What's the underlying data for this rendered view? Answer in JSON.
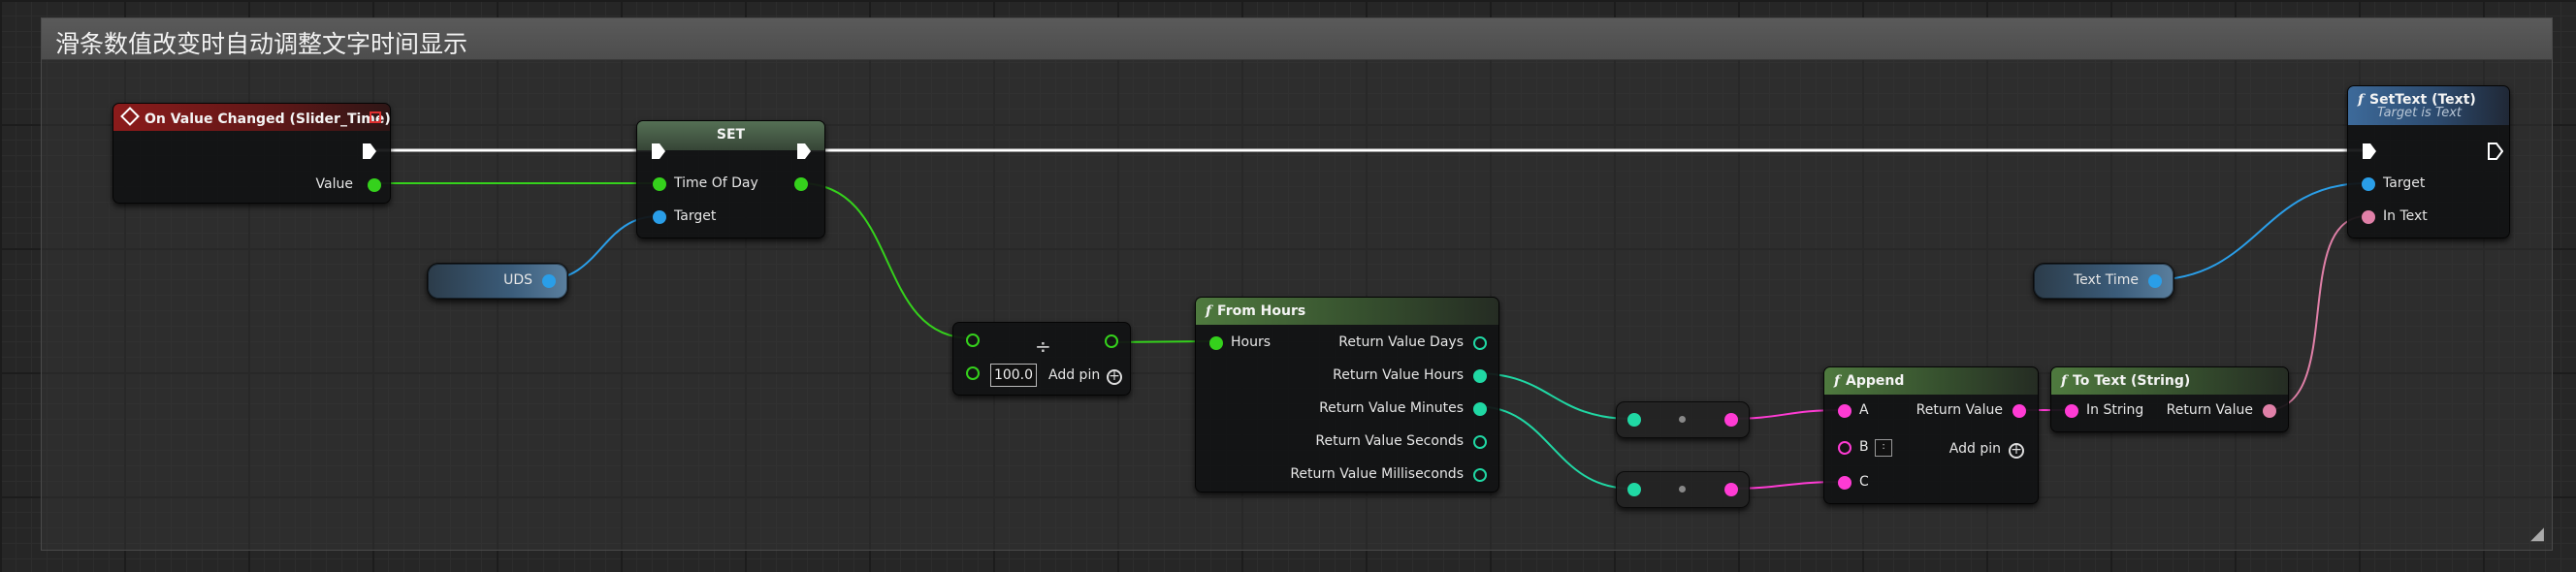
{
  "comment": {
    "title": "滑条数值改变时自动调整文字时间显示"
  },
  "colors": {
    "exec": "#ffffff",
    "float": "#35d11c",
    "object": "#2a9ee8",
    "string": "#ff3bd4",
    "text": "#e080a8",
    "integer": "#20d8a4",
    "event_header": "#8c1b1b",
    "pure_header": "#4f7a3f",
    "function_header": "#3d6a9a"
  },
  "event_node": {
    "title": "On Value Changed (Slider_Time)",
    "icon": "event-diamond-icon",
    "outputs": {
      "value": "Value"
    }
  },
  "set_node": {
    "title": "SET",
    "inputs": {
      "time_of_day": "Time Of Day",
      "target": "Target"
    }
  },
  "uds_node": {
    "label": "UDS"
  },
  "divide_node": {
    "operator": "÷",
    "value": "100.0",
    "add_pin": "Add pin"
  },
  "from_hours_node": {
    "title": "From Hours",
    "inputs": {
      "hours": "Hours"
    },
    "outputs": [
      "Return Value Days",
      "Return Value Hours",
      "Return Value Minutes",
      "Return Value Seconds",
      "Return Value Milliseconds"
    ]
  },
  "append_node": {
    "title": "Append",
    "inputs": {
      "a": "A",
      "b": "B",
      "c": "C"
    },
    "b_value": ":",
    "output": "Return Value",
    "add_pin": "Add pin"
  },
  "to_text_node": {
    "title": "To Text (String)",
    "input": "In String",
    "output": "Return Value"
  },
  "settext_node": {
    "title": "SetText (Text)",
    "subtitle": "Target is Text",
    "inputs": {
      "target": "Target",
      "in_text": "In Text"
    }
  },
  "text_time_node": {
    "label": "Text Time"
  }
}
